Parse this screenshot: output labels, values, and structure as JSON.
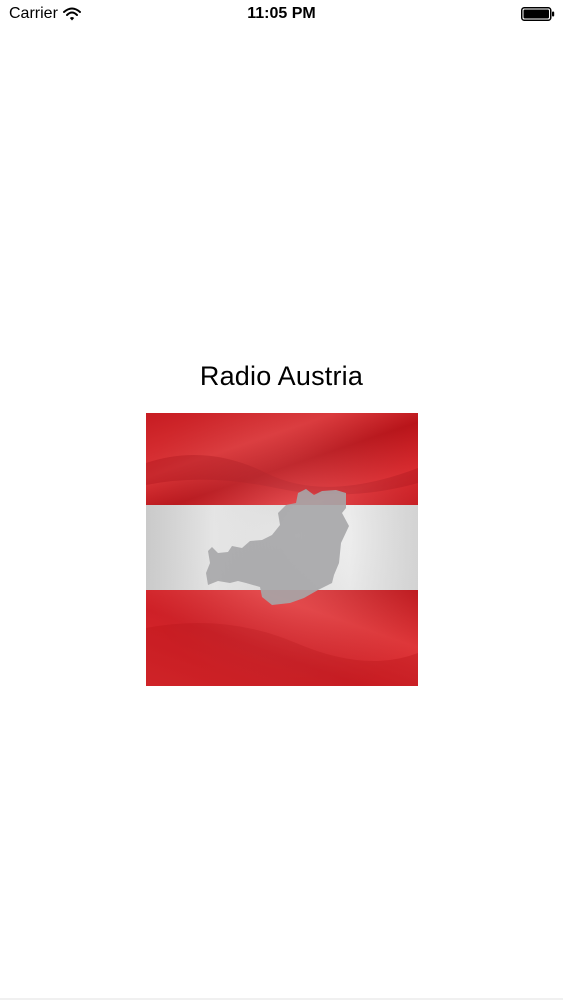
{
  "status_bar": {
    "carrier": "Carrier",
    "time": "11:05 PM",
    "wifi_icon": "wifi-icon",
    "battery_icon": "battery-icon"
  },
  "main": {
    "title": "Radio Austria",
    "image_icon": "austria-flag-image"
  },
  "colors": {
    "flag_red": "#e8262b",
    "flag_white": "#f2f2f2",
    "map_gray": "#a9a9ab"
  }
}
